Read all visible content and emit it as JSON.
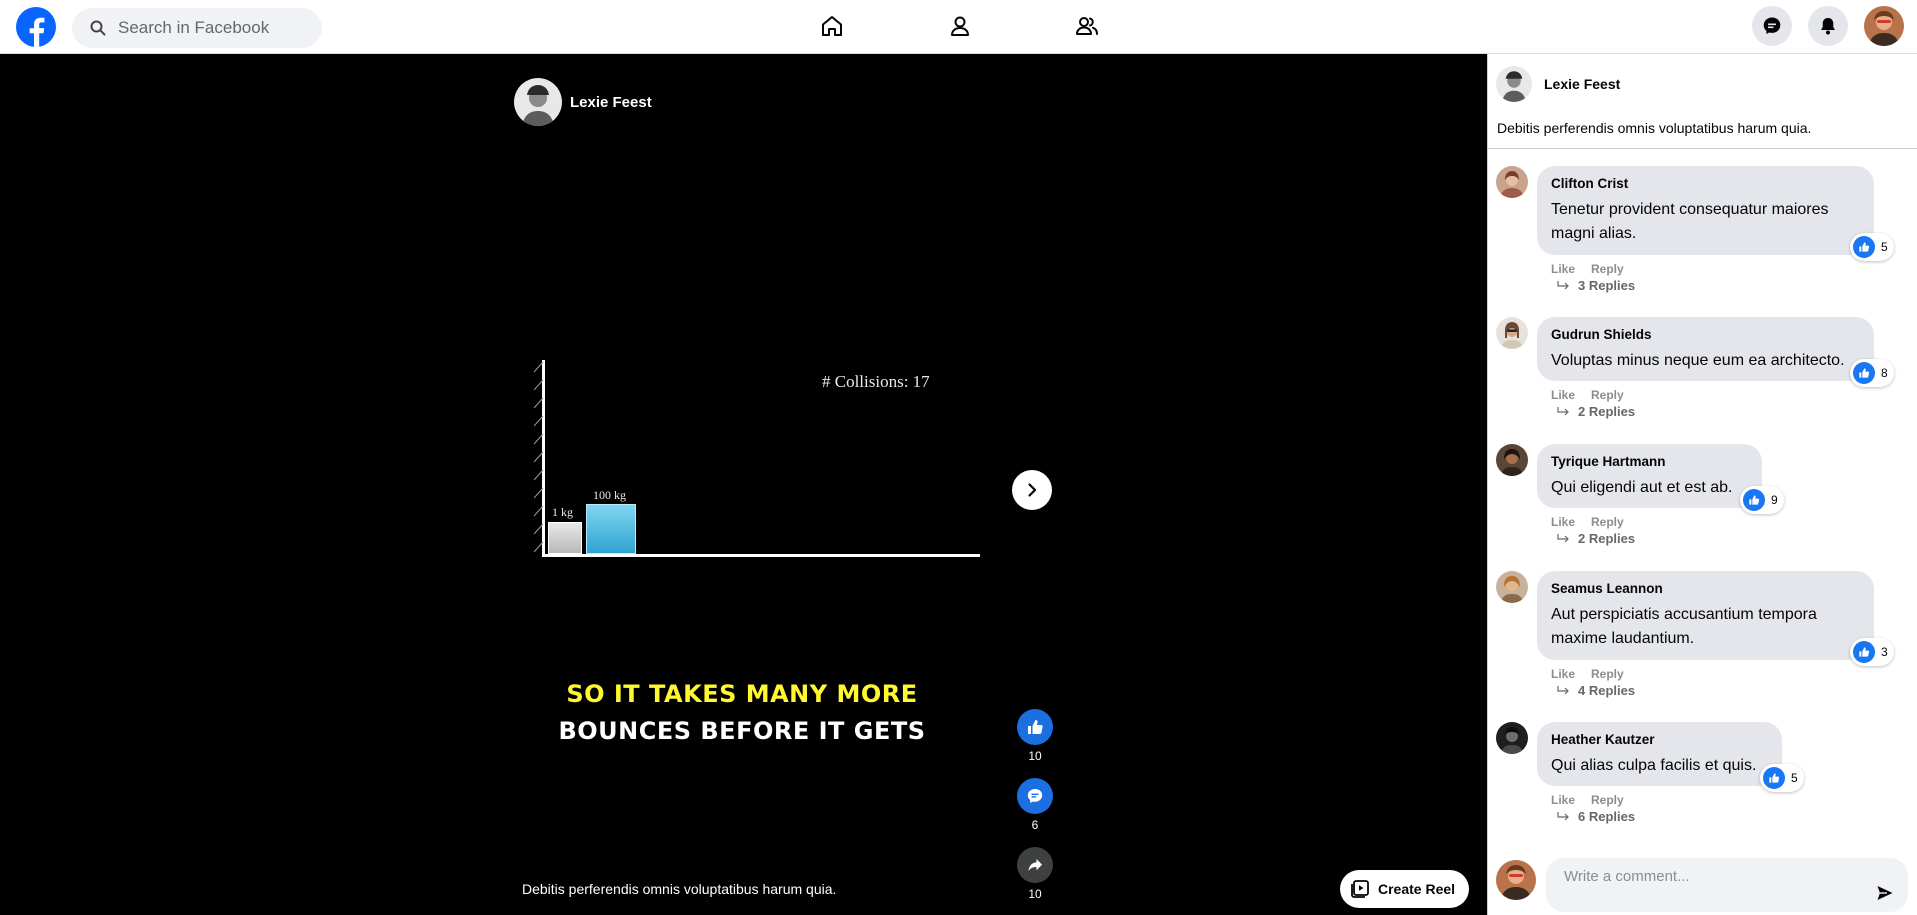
{
  "header": {
    "search_placeholder": "Search in Facebook",
    "nav": [
      "home-icon",
      "profile-icon",
      "friends-icon"
    ],
    "actions": [
      "messenger-icon",
      "bell-icon"
    ],
    "brand_color": "#0866ff"
  },
  "reel": {
    "author": "Lexie Feest",
    "video": {
      "collisions_label": "# Collisions: 17",
      "small_block_label": "1 kg",
      "big_block_label": "100 kg"
    },
    "caption_line1": "SO IT TAKES MANY MORE",
    "caption_line2": "BOUNCES BEFORE IT GETS",
    "description": "Debitis perferendis omnis voluptatibus harum quia.",
    "likes": "10",
    "comments": "6",
    "shares": "10",
    "create_reel_label": "Create Reel"
  },
  "panel": {
    "author": "Lexie Feest",
    "description": "Debitis perferendis omnis voluptatibus harum quia.",
    "like_label": "Like",
    "reply_label": "Reply",
    "comments": [
      {
        "name": "Clifton Crist",
        "text": "Tenetur provident consequatur maiores magni alias.",
        "likes": "5",
        "replies": "3 Replies"
      },
      {
        "name": "Gudrun Shields",
        "text": "Voluptas minus neque eum ea architecto.",
        "likes": "8",
        "replies": "2 Replies"
      },
      {
        "name": "Tyrique Hartmann",
        "text": "Qui eligendi aut et est ab.",
        "likes": "9",
        "replies": "2 Replies"
      },
      {
        "name": "Seamus Leannon",
        "text": "Aut perspiciatis accusantium tempora maxime laudantium.",
        "likes": "3",
        "replies": "4 Replies"
      },
      {
        "name": "Heather Kautzer",
        "text": "Qui alias culpa facilis et quis.",
        "likes": "5",
        "replies": "6 Replies"
      }
    ],
    "comment_placeholder": "Write a comment..."
  }
}
